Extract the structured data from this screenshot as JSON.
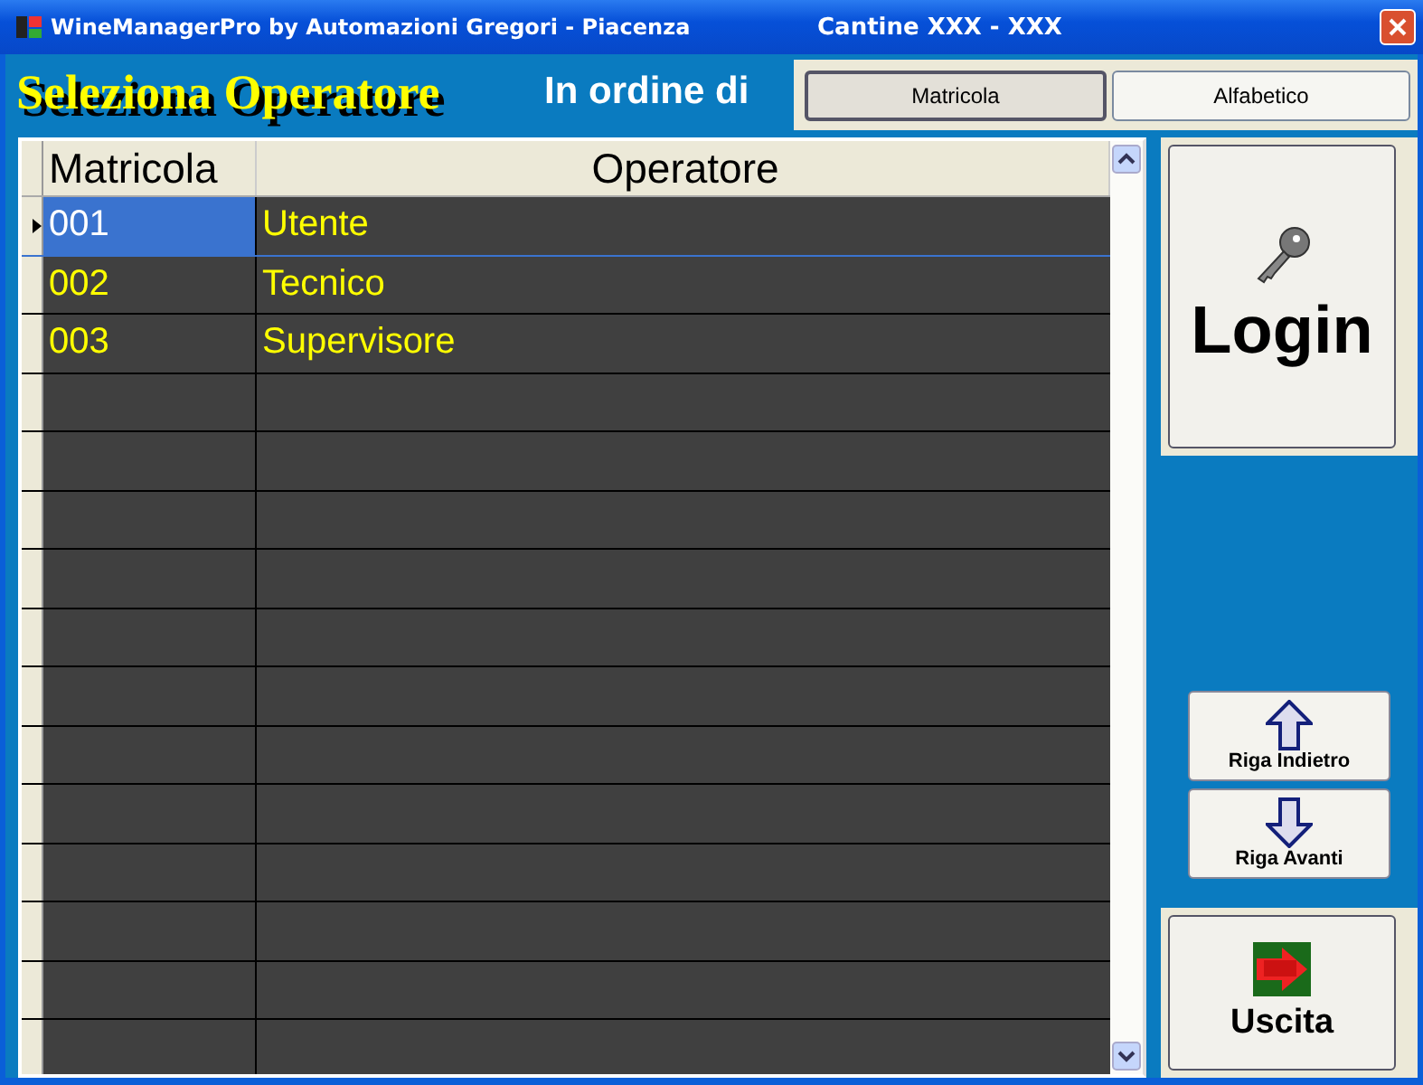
{
  "window": {
    "title": "WineManagerPro by Automazioni Gregori - Piacenza",
    "subtitle": "Cantine XXX - XXX"
  },
  "header": {
    "title": "Seleziona Operatore",
    "order_label": "In ordine di"
  },
  "sort_buttons": [
    {
      "label": "Matricola",
      "selected": true
    },
    {
      "label": "Alfabetico",
      "selected": false
    }
  ],
  "table": {
    "columns": [
      "Matricola",
      "Operatore"
    ],
    "rows": [
      {
        "cells": [
          "001",
          "Utente"
        ],
        "selected": true
      },
      {
        "cells": [
          "002",
          "Tecnico"
        ],
        "selected": false
      },
      {
        "cells": [
          "003",
          "Supervisore"
        ],
        "selected": false
      }
    ]
  },
  "login_button": "Login",
  "nav_buttons": [
    {
      "kind": "up",
      "label": "Riga Indietro"
    },
    {
      "kind": "down",
      "label": "Riga Avanti"
    }
  ],
  "exit_button": "Uscita"
}
